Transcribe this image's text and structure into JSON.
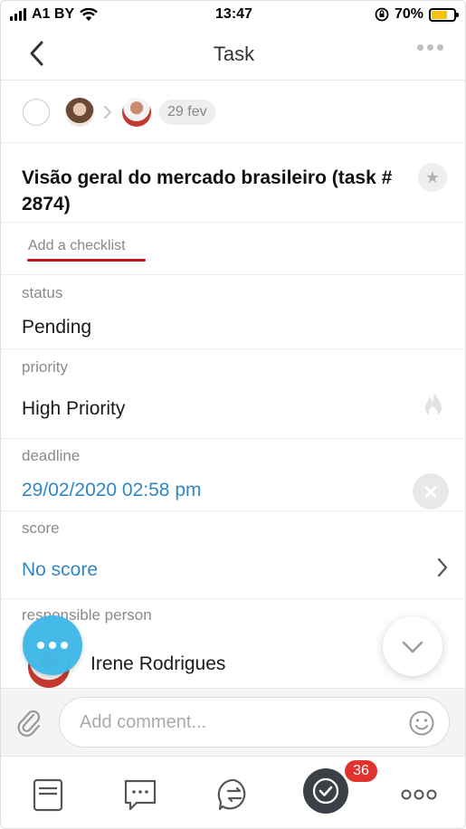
{
  "status_bar": {
    "carrier": "A1 BY",
    "time": "13:47",
    "battery": "70%",
    "battery_level": 0.7
  },
  "nav": {
    "title": "Task"
  },
  "participants": {
    "date": "29 fev"
  },
  "task": {
    "title": "Visão geral do mercado brasileiro (task # 2874)"
  },
  "checklist": {
    "link_label": "Add a checklist"
  },
  "fields": {
    "status": {
      "label": "status",
      "value": "Pending"
    },
    "priority": {
      "label": "priority",
      "value": "High Priority"
    },
    "deadline": {
      "label": "deadline",
      "value": "29/02/2020 02:58 pm"
    },
    "score": {
      "label": "score",
      "value": "No score"
    },
    "responsible": {
      "label": "responsible person",
      "value": "Irene Rodrigues"
    }
  },
  "comment": {
    "placeholder": "Add comment..."
  },
  "tabbar": {
    "tasks_badge": "36"
  },
  "colors": {
    "accent_blue": "#2f87c6",
    "fab_blue": "#40b8e8",
    "badge_red": "#e0332e",
    "underline_red": "#c0141a"
  }
}
